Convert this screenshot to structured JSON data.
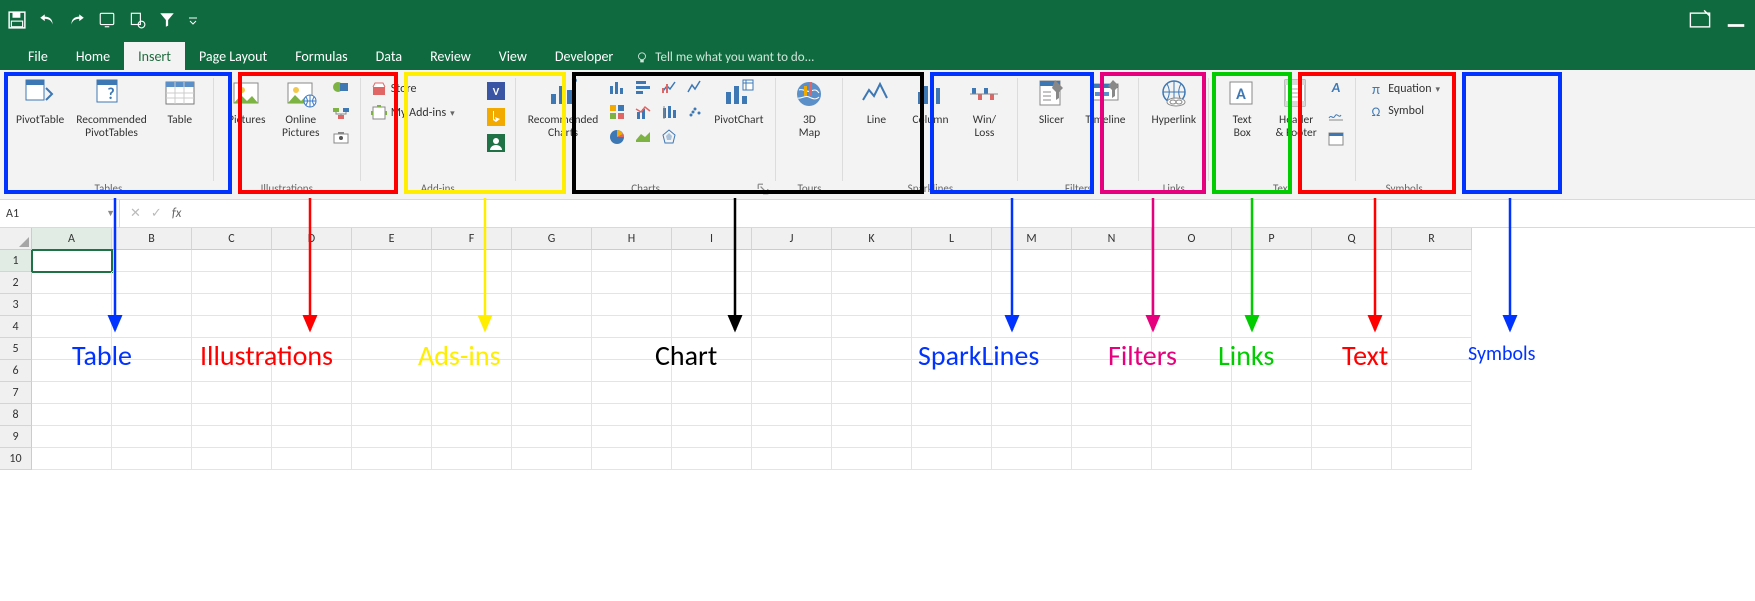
{
  "menu": {
    "tabs": [
      "File",
      "Home",
      "Insert",
      "Page Layout",
      "Formulas",
      "Data",
      "Review",
      "View",
      "Developer"
    ],
    "active_index": 2,
    "tell_me": "Tell me what you want to do..."
  },
  "namebox": "A1",
  "columns": [
    "A",
    "B",
    "C",
    "D",
    "E",
    "F",
    "G",
    "H",
    "I",
    "J",
    "K",
    "L",
    "M",
    "N",
    "O",
    "P",
    "Q",
    "R"
  ],
  "rows": [
    "1",
    "2",
    "3",
    "4",
    "5",
    "6",
    "7",
    "8",
    "9",
    "10"
  ],
  "selected": {
    "col": 0,
    "row": 0
  },
  "ribbon": {
    "tables": {
      "label": "Tables",
      "pivot": "PivotTable",
      "recpivot": "Recommended\nPivotTables",
      "table": "Table"
    },
    "illus": {
      "label": "Illustrations",
      "pictures": "Pictures",
      "online": "Online\nPictures"
    },
    "addins": {
      "label": "Add-ins",
      "store": "Store",
      "myaddins": "My Add-ins"
    },
    "charts": {
      "label": "Charts",
      "rec": "Recommended\nCharts",
      "pivotchart": "PivotChart"
    },
    "tours": {
      "label": "Tours",
      "map": "3D\nMap"
    },
    "spark": {
      "label": "Sparklines",
      "line": "Line",
      "column": "Column",
      "winloss": "Win/\nLoss"
    },
    "filters": {
      "label": "Filters",
      "slicer": "Slicer",
      "timeline": "Timeline"
    },
    "links": {
      "label": "Links",
      "hyperlink": "Hyperlink"
    },
    "text": {
      "label": "Text",
      "textbox": "Text\nBox",
      "headerfooter": "Header\n& Footer"
    },
    "symbols": {
      "label": "Symbols",
      "equation": "Equation",
      "symbol": "Symbol"
    }
  },
  "annotations": {
    "table": "Table",
    "illus": "Illustrations",
    "addins": "Ads-ins",
    "chart": "Chart",
    "spark": "SparkLines",
    "filters": "Filters",
    "links": "Links",
    "text": "Text",
    "symbols": "Symbols"
  },
  "colors": {
    "blue": "#0033ff",
    "red": "#ff0000",
    "yellow": "#ffee00",
    "black": "#000000",
    "magenta": "#e6007e",
    "green": "#00cc00"
  }
}
